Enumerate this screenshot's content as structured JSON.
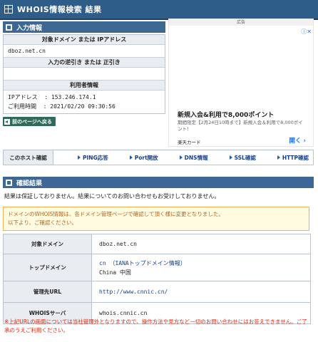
{
  "title": "WHOIS情報検索 結果",
  "input_section": {
    "header": "入力情報",
    "domain_label": "対象ドメイン または IPアドレス",
    "domain_value": "dboz.net.cn",
    "reverse_label": "入力の逆引き または 正引き",
    "reverse_value": "",
    "user_label": "利用者情報",
    "ip_line": "IPアドレス  : 153.246.174.1",
    "time_line": "ご利用時間  : 2021/02/20 09:30:56"
  },
  "back_button": "前のページへ戻る",
  "ad": {
    "label": "広告",
    "close": "ⓘ✕",
    "headline": "新規入会&利用で8,000ポイント",
    "description": "期間限定【2月24日10時まで】新規入会＆利用で8,000ポイント！",
    "brand": "楽天カード",
    "open": "開く ›"
  },
  "host_check": {
    "label": "このホスト確認",
    "links": [
      "PING応答",
      "Port開放",
      "DNS情報",
      "SSL確認",
      "HTTP確認"
    ]
  },
  "result_section": {
    "header": "確認結果",
    "notice": "結果は保証しておりません。結果についてのお問い合わせもお受けしておりません。",
    "warning_line1": "ドメインのWHOIS情報は、各ドメイン管理ページで確認して頂く様に変更となりました。",
    "warning_line2": "以下より、ご確認ください。",
    "rows": [
      {
        "key": "対象ドメイン",
        "value": "dboz.net.cn",
        "value2": ""
      },
      {
        "key": "トップドメイン",
        "value": "cn  （IANAトップドメイン情報）",
        "value2": "China   中国"
      },
      {
        "key": "管理先URL",
        "value": "http://www.cnnic.cn/",
        "value2": ""
      },
      {
        "key": "WHOISサーバ",
        "value": "whois.cnnic.cn",
        "value2": ""
      }
    ],
    "footer": "※上記URLの画面については当社管理外となりますので、操作方法や見方など一切のお問い合わせにはお答えできません。ご了承のうえご利用ください。"
  }
}
